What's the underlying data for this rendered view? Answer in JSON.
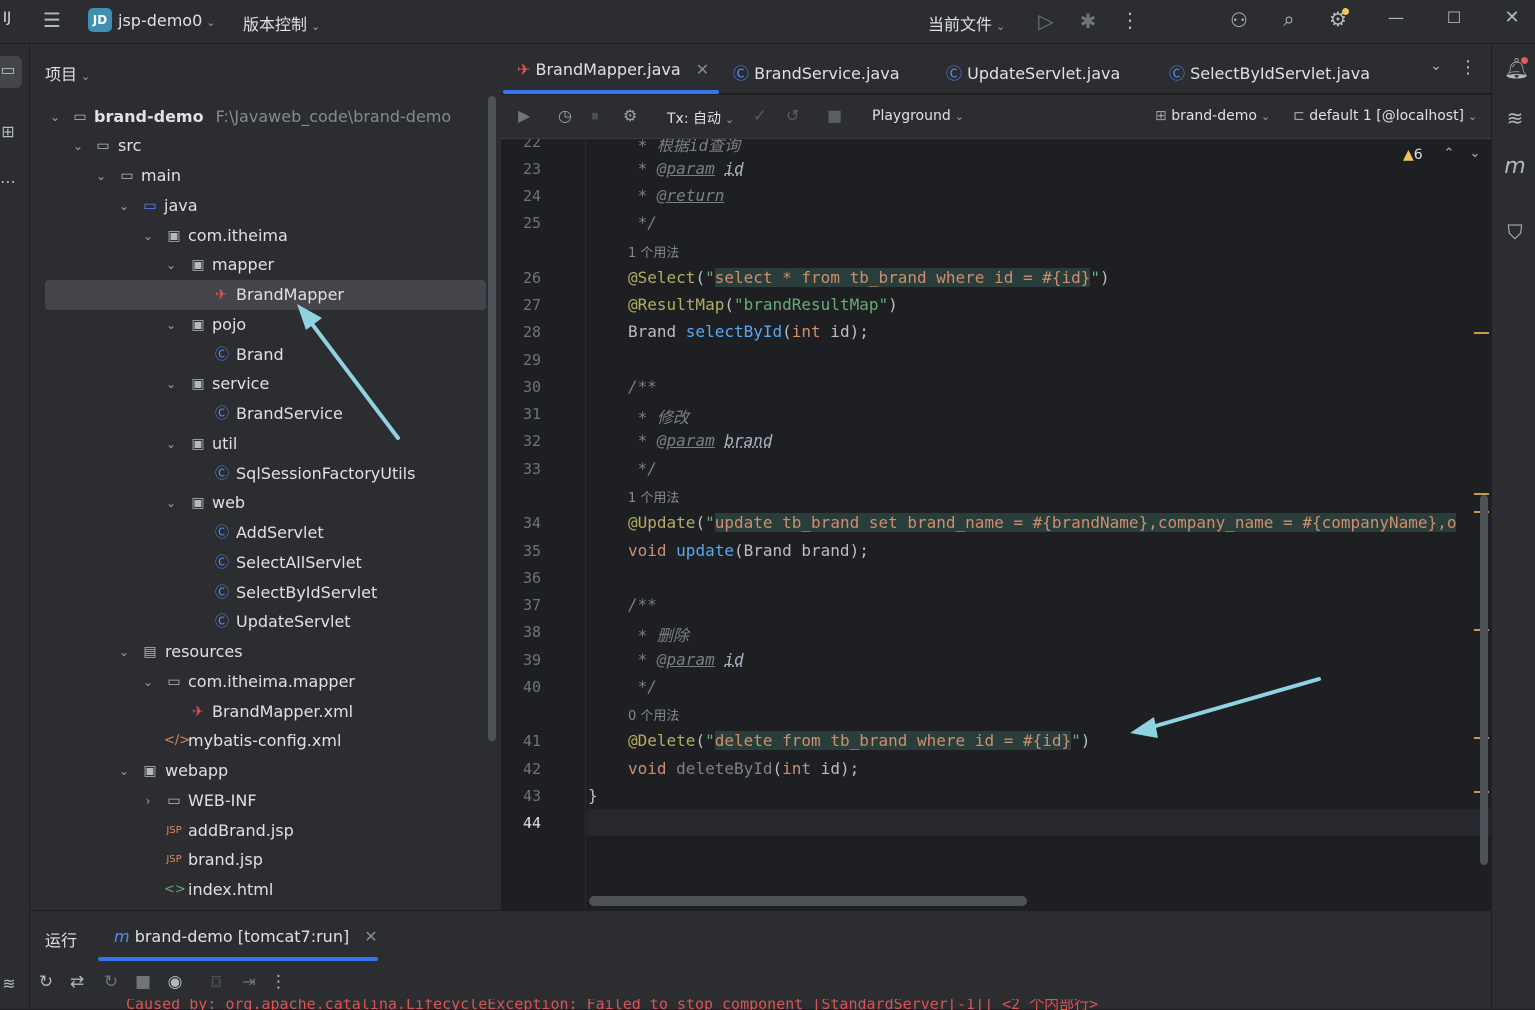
{
  "titlebar": {
    "project_badge": "JD",
    "project_name": "jsp-demo0",
    "vcs": "版本控制",
    "run_config": "当前文件"
  },
  "project_panel": {
    "title": "项目",
    "tree": [
      {
        "label": "brand-demo",
        "sub": "F:\\Javaweb_code\\brand-demo"
      },
      {
        "label": "src"
      },
      {
        "label": "main"
      },
      {
        "label": "java"
      },
      {
        "label": "com.itheima"
      },
      {
        "label": "mapper"
      },
      {
        "label": "BrandMapper"
      },
      {
        "label": "pojo"
      },
      {
        "label": "Brand"
      },
      {
        "label": "service"
      },
      {
        "label": "BrandService"
      },
      {
        "label": "util"
      },
      {
        "label": "SqlSessionFactoryUtils"
      },
      {
        "label": "web"
      },
      {
        "label": "AddServlet"
      },
      {
        "label": "SelectAllServlet"
      },
      {
        "label": "SelectByIdServlet"
      },
      {
        "label": "UpdateServlet"
      },
      {
        "label": "resources"
      },
      {
        "label": "com.itheima.mapper"
      },
      {
        "label": "BrandMapper.xml"
      },
      {
        "label": "mybatis-config.xml"
      },
      {
        "label": "webapp"
      },
      {
        "label": "WEB-INF"
      },
      {
        "label": "addBrand.jsp"
      },
      {
        "label": "brand.jsp"
      },
      {
        "label": "index.html"
      }
    ]
  },
  "tabs": [
    "BrandMapper.java",
    "BrandService.java",
    "UpdateServlet.java",
    "SelectByIdServlet.java"
  ],
  "toolbar": {
    "tx": "Tx: 自动",
    "playground": "Playground",
    "datasource": "brand-demo",
    "session": "default 1 [@localhost]",
    "warnings": "6"
  },
  "editor": {
    "line_numbers": [
      "22",
      "23",
      "24",
      "25",
      "26",
      "27",
      "28",
      "29",
      "30",
      "31",
      "32",
      "33",
      "34",
      "35",
      "36",
      "37",
      "38",
      "39",
      "40",
      "41",
      "42",
      "43",
      "44"
    ],
    "usage_hints": [
      "1 个用法",
      "1 个用法",
      "0 个用法"
    ],
    "comments": {
      "line22": "根据id查询",
      "line31": "修改",
      "line38": "删除"
    },
    "code": {
      "param": "@param",
      "return": "@return",
      "id": "id",
      "brand": "brand",
      "select_ann": "@Select",
      "select_sql": "select * from tb_brand where id = #{id}",
      "resultmap_ann": "@ResultMap",
      "resultmap_val": "\"brandResultMap\"",
      "select_method": "selectById",
      "update_ann": "@Update",
      "update_sql": "update tb_brand set brand_name = #{brandName},company_name = #{companyName},o",
      "update_method": "update",
      "delete_ann": "@Delete",
      "delete_sql": "delete from tb_brand where id = #{id}",
      "delete_method": "deleteById"
    }
  },
  "run_panel": {
    "label": "运行",
    "tab": "brand-demo [tomcat7:run]",
    "log_line": "Caused by: org.apache.catalina.LifecycleException: Failed to stop component [StandardServer[-1]] <2 个内部行>"
  },
  "colors": {
    "accent": "#3574f0",
    "arrow": "#8fd3e0",
    "warning": "#f2c55c"
  }
}
